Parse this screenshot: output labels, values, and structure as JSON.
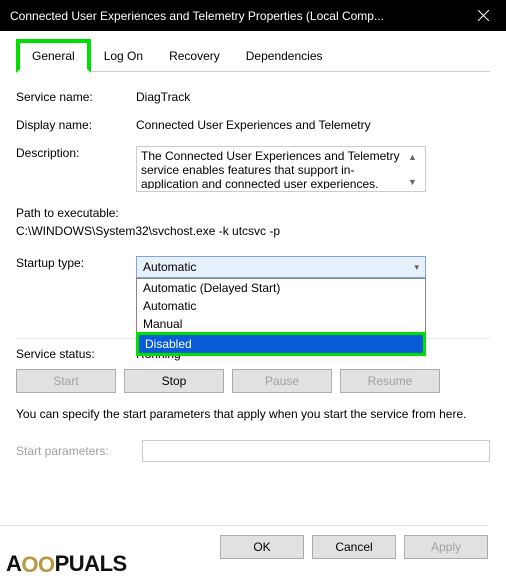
{
  "titlebar": {
    "text": "Connected User Experiences and Telemetry Properties (Local Comp..."
  },
  "tabs": [
    "General",
    "Log On",
    "Recovery",
    "Dependencies"
  ],
  "active_tab": "General",
  "fields": {
    "service_name_label": "Service name:",
    "service_name_value": "DiagTrack",
    "display_name_label": "Display name:",
    "display_name_value": "Connected User Experiences and Telemetry",
    "description_label": "Description:",
    "description_value": "The Connected User Experiences and Telemetry service enables features that support in-application and connected user experiences. Additionally, this",
    "path_label": "Path to executable:",
    "path_value": "C:\\WINDOWS\\System32\\svchost.exe -k utcsvc -p",
    "startup_type_label": "Startup type:",
    "startup_selected": "Automatic",
    "startup_options": [
      "Automatic (Delayed Start)",
      "Automatic",
      "Manual",
      "Disabled"
    ],
    "startup_highlighted": "Disabled",
    "service_status_label": "Service status:",
    "service_status_value": "Running"
  },
  "buttons": {
    "start": "Start",
    "stop": "Stop",
    "pause": "Pause",
    "resume": "Resume",
    "ok": "OK",
    "cancel": "Cancel",
    "apply": "Apply"
  },
  "info_text": "You can specify the start parameters that apply when you start the service from here.",
  "start_params_label": "Start parameters:",
  "watermark": {
    "a1": "A",
    "oo": "OO",
    "puals": "PUALS"
  }
}
